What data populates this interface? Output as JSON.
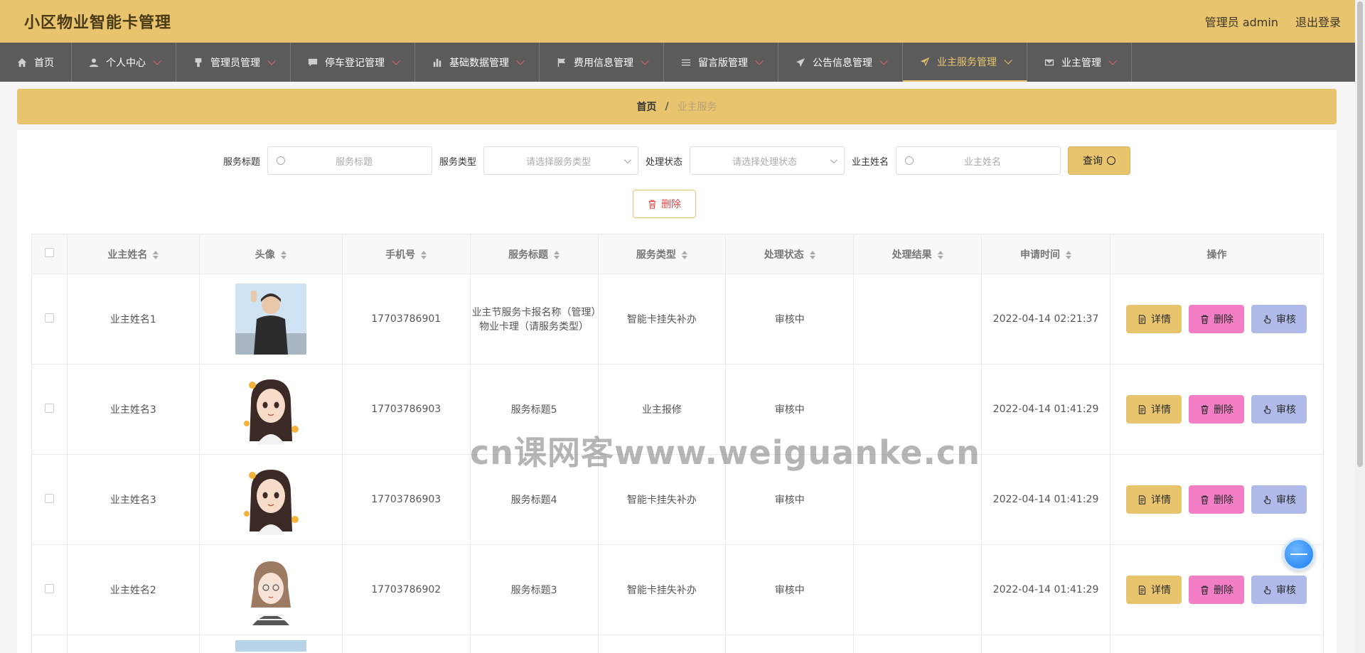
{
  "app": {
    "title": "小区物业智能卡管理"
  },
  "header": {
    "user_label": "管理员 admin",
    "logout": "退出登录"
  },
  "nav": [
    {
      "label": "首页",
      "icon": "home-icon"
    },
    {
      "label": "个人中心",
      "icon": "user-icon"
    },
    {
      "label": "管理员管理",
      "icon": "admin-icon"
    },
    {
      "label": "停车登记管理",
      "icon": "chat-icon"
    },
    {
      "label": "基础数据管理",
      "icon": "bar-chart-icon"
    },
    {
      "label": "费用信息管理",
      "icon": "flag-icon"
    },
    {
      "label": "留言版管理",
      "icon": "list-icon"
    },
    {
      "label": "公告信息管理",
      "icon": "send-icon"
    },
    {
      "label": "业主服务管理",
      "icon": "navigation-icon"
    },
    {
      "label": "业主管理",
      "icon": "mail-icon"
    }
  ],
  "breadcrumb": {
    "home": "首页",
    "separator": "/",
    "current": "业主服务"
  },
  "search": {
    "title_label": "服务标题",
    "title_placeholder": "服务标题",
    "type_label": "服务类型",
    "type_placeholder": "请选择服务类型",
    "status_label": "处理状态",
    "status_placeholder": "请选择处理状态",
    "owner_label": "业主姓名",
    "owner_placeholder": "业主姓名",
    "query_button": "查询"
  },
  "toolbar": {
    "delete_button": "删除"
  },
  "table": {
    "headers": [
      "业主姓名",
      "头像",
      "手机号",
      "服务标题",
      "服务类型",
      "处理状态",
      "处理结果",
      "申请时间",
      "操作"
    ],
    "rows": [
      {
        "name": "业主姓名1",
        "phone": "17703786901",
        "title": "业主节服务卡报名称（管理）物业卡理（请服务类型）",
        "type": "智能卡挂失补办",
        "status": "审核中",
        "result": "",
        "time": "2022-04-14 02:21:37",
        "avatar": "photo-boy"
      },
      {
        "name": "业主姓名3",
        "phone": "17703786903",
        "title": "服务标题5",
        "type": "业主报修",
        "status": "审核中",
        "result": "",
        "time": "2022-04-14 01:41:29",
        "avatar": "cartoon-girl"
      },
      {
        "name": "业主姓名3",
        "phone": "17703786903",
        "title": "服务标题4",
        "type": "智能卡挂失补办",
        "status": "审核中",
        "result": "",
        "time": "2022-04-14 01:41:29",
        "avatar": "cartoon-girl"
      },
      {
        "name": "业主姓名2",
        "phone": "17703786902",
        "title": "服务标题3",
        "type": "智能卡挂失补办",
        "status": "审核中",
        "result": "",
        "time": "2022-04-14 01:41:29",
        "avatar": "sketch-girl"
      }
    ],
    "actions": {
      "detail": "详情",
      "delete": "删除",
      "audit": "审核"
    }
  },
  "watermark": "cn课网客www.weiguanke.cn"
}
